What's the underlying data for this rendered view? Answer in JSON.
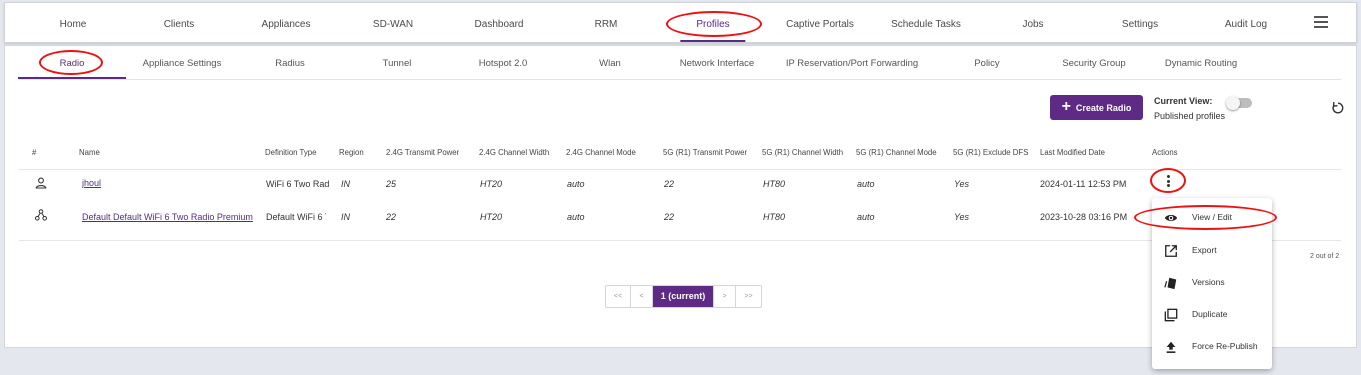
{
  "topnav": {
    "items": [
      "Home",
      "Clients",
      "Appliances",
      "SD-WAN",
      "Dashboard",
      "RRM",
      "Profiles",
      "Captive Portals",
      "Schedule Tasks",
      "Jobs",
      "Settings",
      "Audit Log"
    ],
    "active": "Profiles",
    "menu_icon": "hamburger-icon"
  },
  "subnav": {
    "items": [
      "Radio",
      "Appliance Settings",
      "Radius",
      "Tunnel",
      "Hotspot 2.0",
      "Wlan",
      "Network Interface",
      "IP Reservation/Port Forwarding",
      "Policy",
      "Security Group",
      "Dynamic Routing"
    ],
    "active": "Radio"
  },
  "toolbar": {
    "create_label": "Create Radio",
    "current_view_label": "Current View:",
    "current_view_value": "Published profiles",
    "refresh_icon": "refresh-icon"
  },
  "table": {
    "headers": [
      "#",
      "Name",
      "Definition Type",
      "Region",
      "2.4G Transmit Power",
      "2.4G Channel Width",
      "2.4G Channel Mode",
      "5G (R1) Transmit Power",
      "5G (R1) Channel Width",
      "5G (R1) Channel Mode",
      "5G (R1) Exclude DFS",
      "Last Modified Date",
      "Actions"
    ],
    "rows": [
      {
        "icon": "user-icon",
        "name": "jhoul",
        "definition_type": "WiFi 6 Two Radio",
        "region": "IN",
        "tx24": "25",
        "cw24": "HT20",
        "cm24": "auto",
        "tx5": "22",
        "cw5": "HT80",
        "cm5": "auto",
        "dfs": "Yes",
        "modified": "2024-01-11 12:53 PM"
      },
      {
        "icon": "share-network-icon",
        "name": "Default Default WiFi 6 Two Radio Premium",
        "definition_type": "Default WiFi 6 Two Radio",
        "region": "IN",
        "tx24": "22",
        "cw24": "HT20",
        "cm24": "auto",
        "tx5": "22",
        "cw5": "HT80",
        "cm5": "auto",
        "dfs": "Yes",
        "modified": "2023-10-28 03:16 PM"
      }
    ],
    "count_text": "2 out of 2"
  },
  "pagination": {
    "first": "<<",
    "prev": "<",
    "current": "1 (current)",
    "next": ">",
    "last": ">>"
  },
  "action_menu": {
    "items": [
      {
        "label": "View / Edit",
        "icon": "eye-icon"
      },
      {
        "label": "Export",
        "icon": "external-link-icon"
      },
      {
        "label": "Versions",
        "icon": "versions-icon"
      },
      {
        "label": "Duplicate",
        "icon": "duplicate-icon"
      },
      {
        "label": "Force Re-Publish",
        "icon": "upload-icon"
      }
    ]
  },
  "colors": {
    "accent": "#5e2a86",
    "annotation": "#ee1111"
  }
}
